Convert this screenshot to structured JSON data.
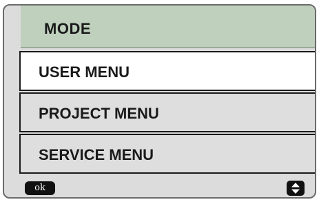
{
  "header": {
    "title": "MODE"
  },
  "menu": {
    "items": [
      {
        "label": "USER MENU",
        "selected": true
      },
      {
        "label": "PROJECT MENU",
        "selected": false
      },
      {
        "label": "SERVICE MENU",
        "selected": false
      }
    ]
  },
  "footer": {
    "ok_label": "ok",
    "updown_icon": "up-down-arrows-icon"
  },
  "colors": {
    "header_background": "#bfd0bd",
    "selected_background": "#ffffff",
    "item_background": "#dedede",
    "button_background": "#111111"
  }
}
